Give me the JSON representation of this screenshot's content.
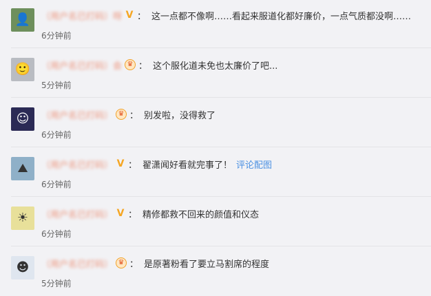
{
  "comments": [
    {
      "name": "（用户名已打码）呀",
      "badge": "V",
      "text": "这一点都不像啊……看起来服道化都好廉价，一点气质都没啊……",
      "time": "6分钟前",
      "avatar_icon": "person-avatar-icon",
      "avatar_color": "#6e8f5c"
    },
    {
      "name": "（用户名已打码）会",
      "badge": "crown",
      "text": "这个服化道未免也太廉价了吧...",
      "time": "5分钟前",
      "avatar_icon": "portrait-avatar-icon",
      "avatar_color": "#b9bcc2"
    },
    {
      "name": "（用户名已打码）",
      "badge": "crown",
      "text": "别发啦，没得救了",
      "time": "6分钟前",
      "avatar_icon": "anime-avatar-icon",
      "avatar_color": "#2b2a55"
    },
    {
      "name": "（用户名已打码）",
      "badge": "V",
      "text": "翟潇闻好看就完事了！",
      "link": "评论配图",
      "time": "6分钟前",
      "avatar_icon": "landscape-avatar-icon",
      "avatar_color": "#8fb0c8"
    },
    {
      "name": "（用户名已打码）",
      "badge": "V",
      "text": "精修都救不回来的颜值和仪态",
      "time": "6分钟前",
      "avatar_icon": "yellow-avatar-icon",
      "avatar_color": "#e8e09a"
    },
    {
      "name": "（用户名已打码）",
      "badge": "crown",
      "text": "是原著粉看了要立马割席的程度",
      "time": "5分钟前",
      "avatar_icon": "cartoon-avatar-icon",
      "avatar_color": "#dfe6ef"
    }
  ]
}
